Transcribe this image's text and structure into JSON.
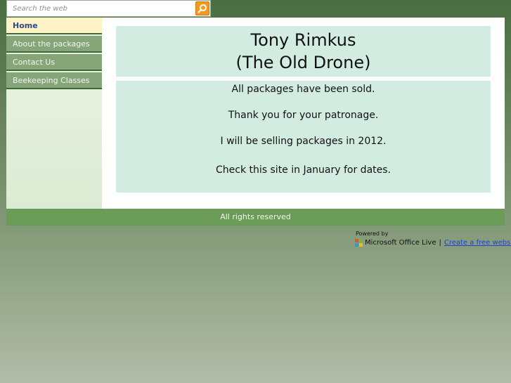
{
  "search": {
    "placeholder": "Search the web"
  },
  "nav": {
    "items": [
      {
        "label": "Home",
        "active": true
      },
      {
        "label": "About the packages",
        "active": false
      },
      {
        "label": "Contact Us",
        "active": false
      },
      {
        "label": "Beekeeping Classes",
        "active": false
      }
    ]
  },
  "header": {
    "title_line1": "Tony Rimkus",
    "title_line2": "(The Old Drone)"
  },
  "body": {
    "lines": [
      "All packages have been sold.",
      "Thank you for your patronage.",
      "I will be selling packages in 2012.",
      "Check this site in January for dates."
    ]
  },
  "footer": {
    "text": "All rights reserved"
  },
  "powered": {
    "label": "Powered by",
    "brand": "Microsoft Office Live",
    "separator": "|",
    "link": "Create a free website"
  },
  "colors": {
    "accent_orange": "#f39a1d",
    "nav_active_bg": "#fdf3c7",
    "nav_bg": "#86a679",
    "content_bg": "#d3ece1",
    "footer_bg": "#6a9c58"
  }
}
